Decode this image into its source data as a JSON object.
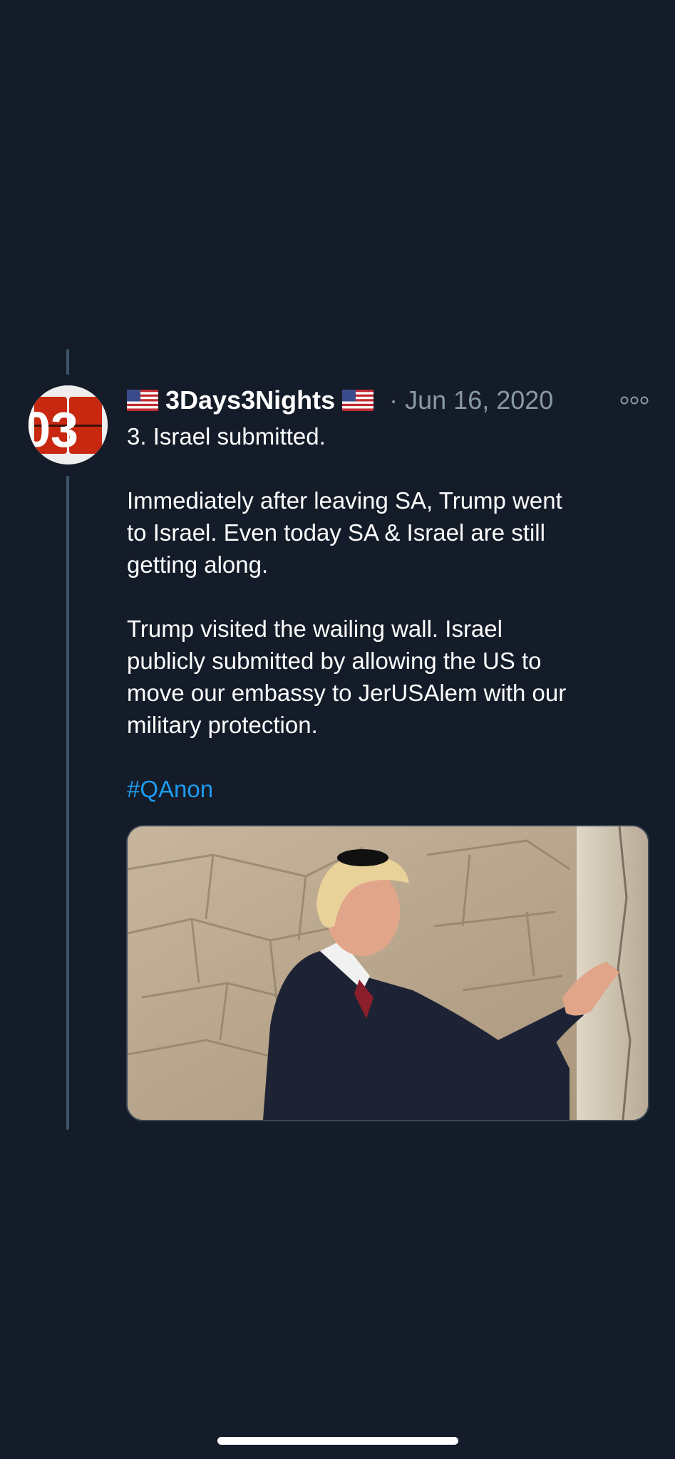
{
  "tweet": {
    "display_name": "3Days3Nights",
    "separator": "·",
    "date": "Jun 16, 2020",
    "avatar_text": "03",
    "lines": [
      "3. Israel submitted.",
      "Immediately after leaving SA, Trump went",
      "to Israel. Even today SA & Israel are still",
      "getting along.",
      "Trump visited the wailing wall. Israel",
      "publicly submitted by allowing the US to",
      "move our embassy to JerUSAlem with our",
      "military protection."
    ],
    "hashtag": "#QAnon",
    "media": {
      "description_icon": "photo"
    }
  },
  "icons": {
    "flag_left": "us-flag-icon",
    "flag_right": "us-flag-icon",
    "more": "more-options-icon"
  },
  "colors": {
    "background": "#151c29",
    "text": "#ffffff",
    "secondary": "#8899a6",
    "link": "#1d9bf0",
    "thread_line": "#3d5468"
  }
}
